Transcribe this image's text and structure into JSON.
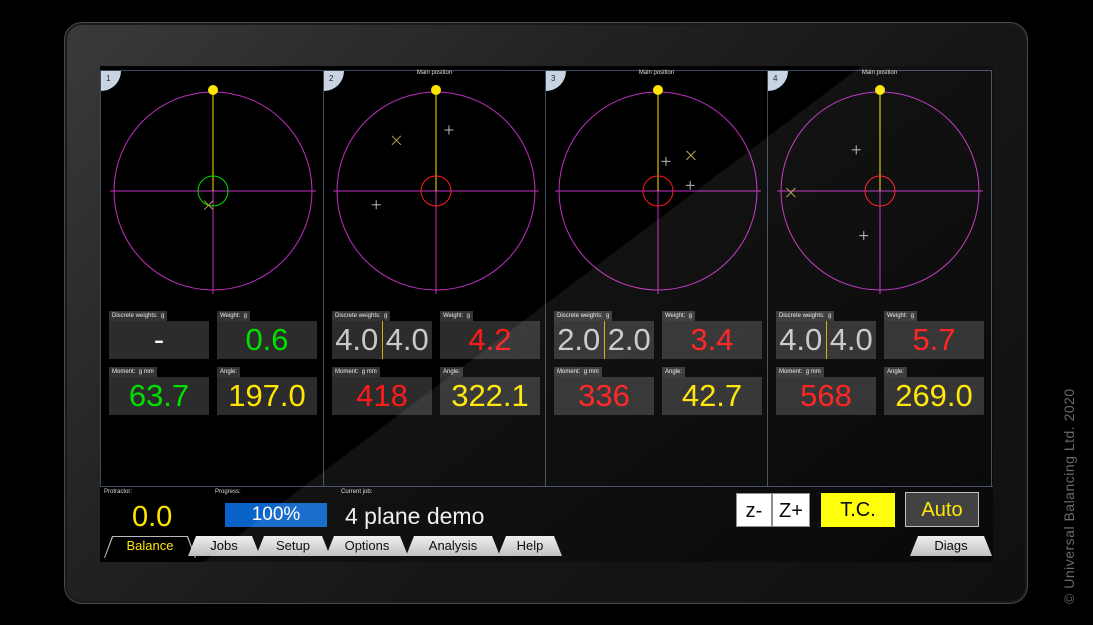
{
  "colors": {
    "green": "#00e000",
    "yellow": "#ffe500",
    "red": "#ff1a1a",
    "grey": "#c8c8c8",
    "magenta": "#c030c0",
    "blue": "#0a63c8"
  },
  "panels": [
    {
      "number": "1",
      "caption": "",
      "center_circle": "#00e000",
      "discrete_label": "Discrete weights:",
      "discrete_unit": "g",
      "discrete_value": "-",
      "discrete_split": false,
      "discrete_a": "",
      "discrete_b": "",
      "discrete_color": "#ffffff",
      "weight_label": "Weight:",
      "weight_unit": "g",
      "weight_value": "0.6",
      "weight_color": "#00e000",
      "moment_label": "Moment:",
      "moment_unit": "g mm",
      "moment_value": "63.7",
      "moment_color": "#00e000",
      "angle_label": "Angle:",
      "angle_value": "197.0",
      "angle_color": "#ffe500",
      "markers": [
        {
          "kind": "x",
          "r": 0.15,
          "a": 197
        }
      ]
    },
    {
      "number": "2",
      "caption": "Main position",
      "center_circle": "#ff1a1a",
      "discrete_label": "Discrete weights:",
      "discrete_unit": "g",
      "discrete_value": "",
      "discrete_split": true,
      "discrete_a": "4.0",
      "discrete_b": "4.0",
      "discrete_color": "#c8c8c8",
      "weight_label": "Weight:",
      "weight_unit": "g",
      "weight_value": "4.2",
      "weight_color": "#ff1a1a",
      "moment_label": "Moment:",
      "moment_unit": "g mm",
      "moment_value": "418",
      "moment_color": "#ff1a1a",
      "angle_label": "Angle:",
      "angle_value": "322.1",
      "angle_color": "#ffe500",
      "markers": [
        {
          "kind": "x",
          "r": 0.65,
          "a": 322
        },
        {
          "kind": "plus",
          "r": 0.63,
          "a": 12
        },
        {
          "kind": "plus",
          "r": 0.62,
          "a": 257
        }
      ]
    },
    {
      "number": "3",
      "caption": "Main position",
      "center_circle": "#ff1a1a",
      "discrete_label": "Discrete weights:",
      "discrete_unit": "g",
      "discrete_value": "",
      "discrete_split": true,
      "discrete_a": "2.0",
      "discrete_b": "2.0",
      "discrete_color": "#c8c8c8",
      "weight_label": "Weight:",
      "weight_unit": "g",
      "weight_value": "3.4",
      "weight_color": "#ff1a1a",
      "moment_label": "Moment:",
      "moment_unit": "g mm",
      "moment_value": "336",
      "moment_color": "#ff1a1a",
      "angle_label": "Angle:",
      "angle_value": "42.7",
      "angle_color": "#ffe500",
      "markers": [
        {
          "kind": "x",
          "r": 0.49,
          "a": 42.7
        },
        {
          "kind": "plus",
          "r": 0.31,
          "a": 15
        },
        {
          "kind": "plus",
          "r": 0.33,
          "a": 80
        }
      ]
    },
    {
      "number": "4",
      "caption": "Main position",
      "center_circle": "#ff1a1a",
      "discrete_label": "Discrete weights:",
      "discrete_unit": "g",
      "discrete_value": "",
      "discrete_split": true,
      "discrete_a": "4.0",
      "discrete_b": "4.0",
      "discrete_color": "#c8c8c8",
      "weight_label": "Weight:",
      "weight_unit": "g",
      "weight_value": "5.7",
      "weight_color": "#ff1a1a",
      "moment_label": "Moment:",
      "moment_unit": "g mm",
      "moment_value": "568",
      "moment_color": "#ff1a1a",
      "angle_label": "Angle:",
      "angle_value": "269.0",
      "angle_color": "#ffe500",
      "markers": [
        {
          "kind": "x",
          "r": 0.9,
          "a": 269
        },
        {
          "kind": "plus",
          "r": 0.48,
          "a": 330
        },
        {
          "kind": "plus",
          "r": 0.48,
          "a": 200
        }
      ]
    }
  ],
  "status": {
    "protractor_label": "Protractor:",
    "protractor_value": "0.0",
    "progress_label": "Progress:",
    "progress_value": "100%",
    "progress_fraction": 1.0,
    "job_label": "Current job:",
    "job_name": "4 plane demo"
  },
  "buttons": {
    "zminus": "z-",
    "zplus": "Z+",
    "tc": "T.C.",
    "auto": "Auto"
  },
  "tabs": [
    "Balance",
    "Jobs",
    "Setup",
    "Options",
    "Analysis",
    "Help"
  ],
  "tab_right": "Diags",
  "copyright": "© Universal Balancing Ltd. 2020"
}
